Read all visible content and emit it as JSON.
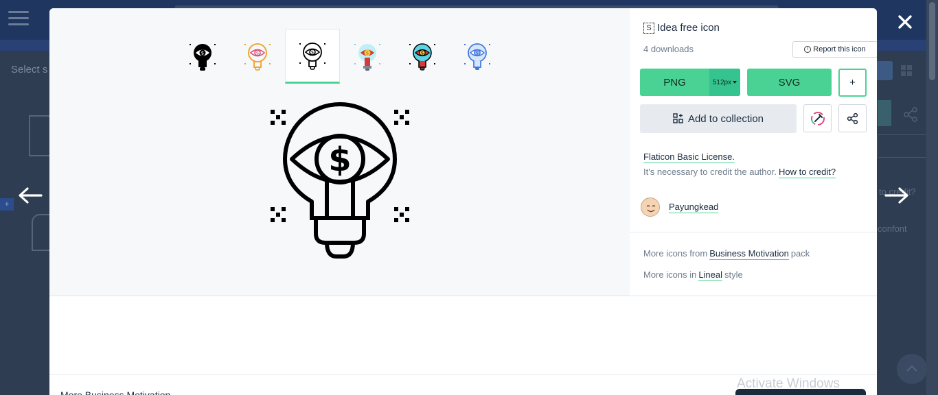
{
  "background": {
    "select_hint": "Select s",
    "side_hint_1": "to credit?",
    "side_hint_2": "confont"
  },
  "icon": {
    "title": "Idea free icon",
    "title_glyph": "S",
    "downloads": "4 downloads",
    "report_label": "Report this icon"
  },
  "download": {
    "png_label": "PNG",
    "png_size": "512px",
    "svg_label": "SVG",
    "plus_label": "+",
    "collection_label": "Add to collection"
  },
  "license": {
    "name": "Flaticon Basic License.",
    "note": "It's necessary to credit the author.",
    "how_to_credit": "How to credit?"
  },
  "author": {
    "name": "Payungkead"
  },
  "more": {
    "pack_prefix": "More icons from",
    "pack_name": "Business Motivation",
    "pack_suffix": "pack",
    "style_prefix": "More icons in",
    "style_name": "Lineal",
    "style_suffix": "style"
  },
  "variants": [
    {
      "name": "glyph",
      "color": "#000000"
    },
    {
      "name": "lineal-color-orange",
      "color": "#f0a020"
    },
    {
      "name": "lineal",
      "color": "#000000"
    },
    {
      "name": "flat",
      "color": "#d63a3a"
    },
    {
      "name": "lineal-color",
      "color": "#1c9bd1"
    },
    {
      "name": "blue",
      "color": "#3f74e0"
    }
  ],
  "bottom": {
    "label": "More Business Motivation"
  },
  "watermark": "Activate Windows",
  "colors": {
    "accent": "#4ad295",
    "overlay": "#2f3d52"
  }
}
